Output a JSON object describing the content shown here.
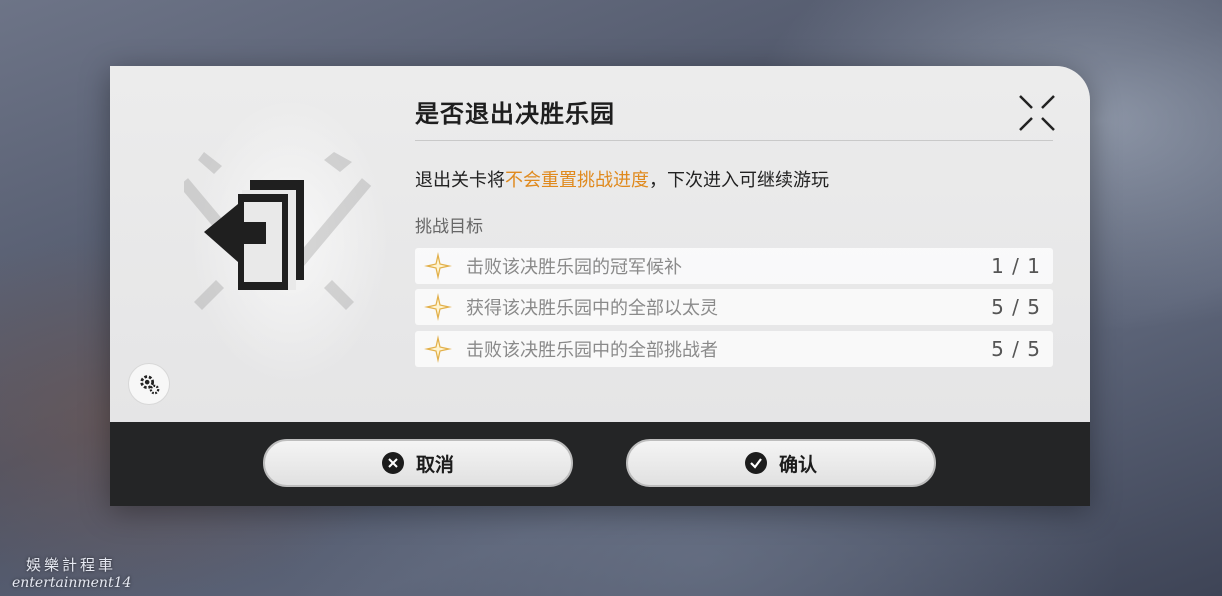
{
  "dialog": {
    "title": "是否退出决胜乐园",
    "message_pre": "退出关卡将",
    "message_highlight": "不会重置挑战进度",
    "message_post": "，下次进入可继续游玩",
    "highlight_color": "#e08a1e",
    "goals_heading": "挑战目标",
    "goals": [
      {
        "text": "击败该决胜乐园的冠军候补",
        "progress": "1 / 1"
      },
      {
        "text": "获得该决胜乐园中的全部以太灵",
        "progress": "5 / 5"
      },
      {
        "text": "击败该决胜乐园中的全部挑战者",
        "progress": "5 / 5"
      }
    ],
    "icons": {
      "art": "exit-door-icon",
      "close": "close-icon",
      "settings": "gear-icon",
      "goal": "star-icon"
    }
  },
  "buttons": {
    "cancel_label": "取消",
    "confirm_label": "确认"
  },
  "watermark": {
    "line1": "娛樂計程車",
    "line2": "entertainment14"
  }
}
